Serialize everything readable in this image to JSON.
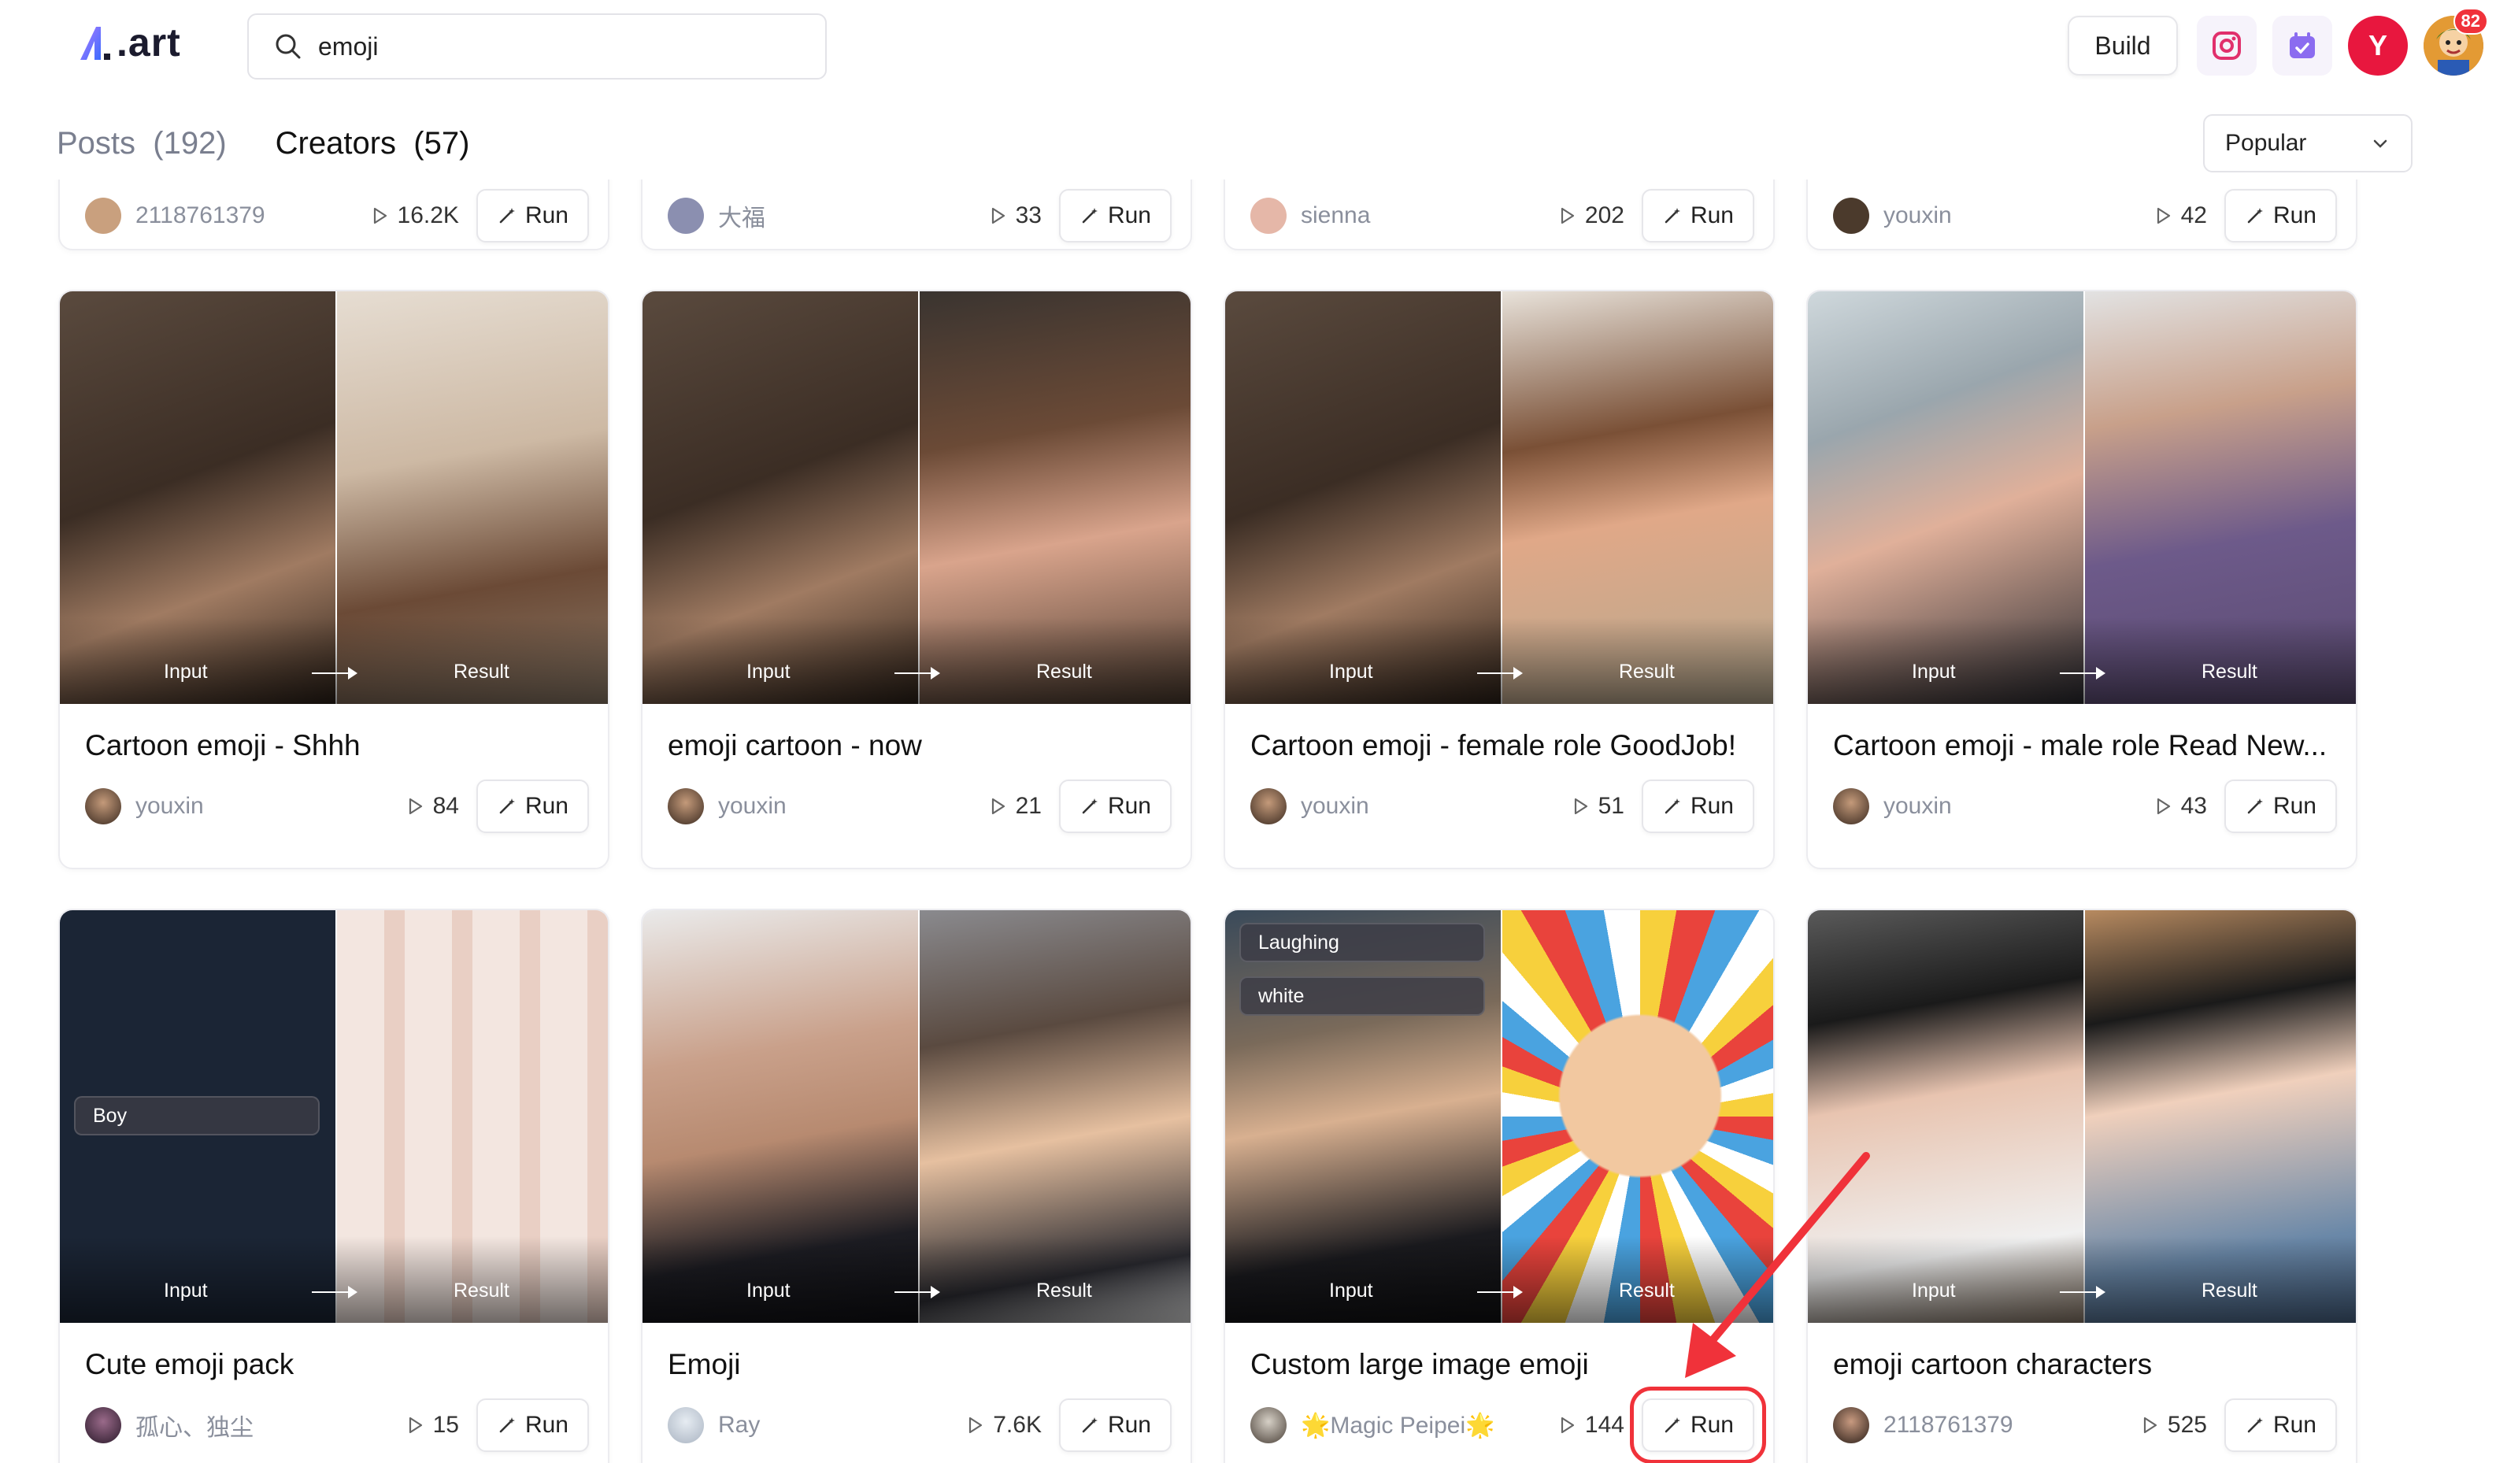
{
  "header": {
    "logo_text": ".art",
    "search": {
      "value": "emoji",
      "placeholder": ""
    },
    "build_label": "Build",
    "avatar_letter": "Y",
    "notification_count": "82"
  },
  "tabs": {
    "posts": {
      "label": "Posts",
      "count": "(192)"
    },
    "creators": {
      "label": "Creators",
      "count": "(57)"
    }
  },
  "sort": {
    "selected": "Popular"
  },
  "run_label": "Run",
  "partial_row": [
    {
      "author": "2118761379",
      "runs": "16.2K"
    },
    {
      "author": "大福",
      "runs": "33"
    },
    {
      "author": "sienna",
      "runs": "202"
    },
    {
      "author": "youxin",
      "runs": "42"
    }
  ],
  "cards": [
    {
      "title": "Cartoon emoji - Shhh",
      "author": "youxin",
      "runs": "84",
      "input_label": "Input",
      "result_label": "Result"
    },
    {
      "title": "emoji cartoon - now",
      "author": "youxin",
      "runs": "21",
      "input_label": "Input",
      "result_label": "Result"
    },
    {
      "title": "Cartoon emoji - female role GoodJob!",
      "author": "youxin",
      "runs": "51",
      "input_label": "Input",
      "result_label": "Result"
    },
    {
      "title": "Cartoon emoji - male role Read New...",
      "author": "youxin",
      "runs": "43",
      "input_label": "Input",
      "result_label": "Result"
    },
    {
      "title": "Cute emoji pack",
      "author": "孤心、独尘",
      "runs": "15",
      "input_label": "Input",
      "result_label": "Result",
      "tag": "Boy"
    },
    {
      "title": "Emoji",
      "author": "Ray",
      "runs": "7.6K",
      "input_label": "Input",
      "result_label": "Result"
    },
    {
      "title": "Custom large image emoji",
      "author": "🌟Magic Peipei🌟",
      "runs": "144",
      "input_label": "Input",
      "result_label": "Result",
      "tags": [
        "Laughing",
        "white"
      ]
    },
    {
      "title": "emoji cartoon characters",
      "author": "2118761379",
      "runs": "525",
      "input_label": "Input",
      "result_label": "Result"
    }
  ],
  "colors": {
    "accent_red": "#f0323a",
    "avatar_red": "#e8173e",
    "muted_text": "#8a8f9c"
  }
}
